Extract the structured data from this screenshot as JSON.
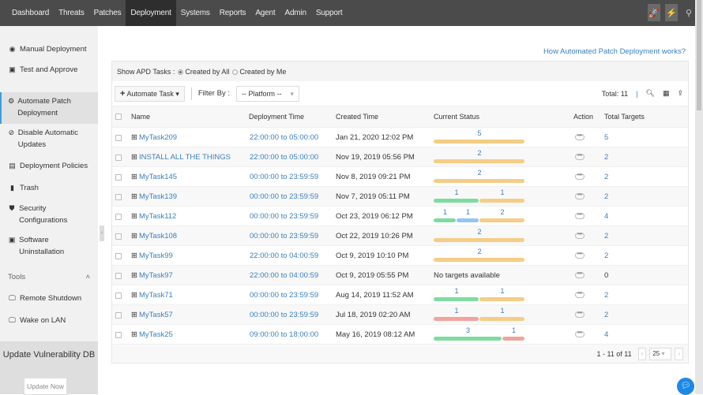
{
  "nav": [
    "Dashboard",
    "Threats",
    "Patches",
    "Deployment",
    "Systems",
    "Reports",
    "Agent",
    "Admin",
    "Support"
  ],
  "nav_active": "Deployment",
  "sidebar": {
    "items": [
      {
        "label": "Manual Deployment",
        "icon": "eye-icon"
      },
      {
        "label": "Test and Approve",
        "icon": "calendar-check-icon"
      },
      {
        "label": "Automate Patch Deployment",
        "icon": "gear-icon"
      },
      {
        "label": "Disable Automatic Updates",
        "icon": "disable-icon"
      },
      {
        "label": "Deployment Policies",
        "icon": "document-icon"
      },
      {
        "label": "Trash",
        "icon": "trash-icon"
      },
      {
        "label": "Security Configurations",
        "icon": "shield-icon"
      },
      {
        "label": "Software Uninstallation",
        "icon": "uninstall-icon"
      }
    ],
    "tools_label": "Tools",
    "tools": [
      {
        "label": "Remote Shutdown"
      },
      {
        "label": "Wake on LAN"
      }
    ],
    "update_title": "Update Vulnerability DB",
    "update_button": "Update Now"
  },
  "help_link": "How Automated Patch Deployment works?",
  "filter": {
    "show_label": "Show APD Tasks :",
    "opt_all": "Created by All",
    "opt_me": "Created by Me",
    "selected": "Created by All"
  },
  "toolbar": {
    "automate": "Automate Task",
    "filter_by": "Filter By :",
    "platform": "-- Platform --",
    "total": "Total: 11"
  },
  "columns": {
    "name": "Name",
    "deploy": "Deployment Time",
    "created": "Created Time",
    "status": "Current Status",
    "action": "Action",
    "targets": "Total Targets"
  },
  "status_colors": {
    "success": "#7ddca0",
    "in_progress": "#93c5f2",
    "pending": "#f5cd86",
    "failed": "#f2a39c"
  },
  "rows": [
    {
      "name": "MyTask209",
      "deploy": "22:00:00 to 05:00:00",
      "created": "Jan 21, 2020 12:02 PM",
      "status": [
        [
          "pending",
          5
        ]
      ],
      "targets": "5"
    },
    {
      "name": "INSTALL ALL THE THINGS",
      "deploy": "22:00:00 to 05:00:00",
      "created": "Nov 19, 2019 05:56 PM",
      "status": [
        [
          "pending",
          2
        ]
      ],
      "targets": "2"
    },
    {
      "name": "MyTask145",
      "deploy": "00:00:00 to 23:59:59",
      "created": "Nov 8, 2019 09:21 PM",
      "status": [
        [
          "pending",
          2
        ]
      ],
      "targets": "2"
    },
    {
      "name": "MyTask139",
      "deploy": "00:00:00 to 23:59:59",
      "created": "Nov 7, 2019 05:11 PM",
      "status": [
        [
          "success",
          1
        ],
        [
          "pending",
          1
        ]
      ],
      "targets": "2"
    },
    {
      "name": "MyTask112",
      "deploy": "00:00:00 to 23:59:59",
      "created": "Oct 23, 2019 06:12 PM",
      "status": [
        [
          "success",
          1
        ],
        [
          "in_progress",
          1
        ],
        [
          "pending",
          2
        ]
      ],
      "targets": "4"
    },
    {
      "name": "MyTask108",
      "deploy": "00:00:00 to 23:59:59",
      "created": "Oct 22, 2019 10:26 PM",
      "status": [
        [
          "pending",
          2
        ]
      ],
      "targets": "2"
    },
    {
      "name": "MyTask99",
      "deploy": "22:00:00 to 04:00:59",
      "created": "Oct 9, 2019 10:10 PM",
      "status": [
        [
          "pending",
          2
        ]
      ],
      "targets": "2"
    },
    {
      "name": "MyTask97",
      "deploy": "22:00:00 to 04:00:59",
      "created": "Oct 9, 2019 05:55 PM",
      "status": [],
      "status_text": "No targets available",
      "targets": "0"
    },
    {
      "name": "MyTask71",
      "deploy": "00:00:00 to 23:59:59",
      "created": "Aug 14, 2019 11:52 AM",
      "status": [
        [
          "success",
          1
        ],
        [
          "pending",
          1
        ]
      ],
      "targets": "2"
    },
    {
      "name": "MyTask57",
      "deploy": "00:00:00 to 23:59:59",
      "created": "Jul 18, 2019 02:20 AM",
      "status": [
        [
          "failed",
          1
        ],
        [
          "pending",
          1
        ]
      ],
      "targets": "2"
    },
    {
      "name": "MyTask25",
      "deploy": "09:00:00 to 18:00:00",
      "created": "May 16, 2019 08:12 AM",
      "status": [
        [
          "success",
          3
        ],
        [
          "failed",
          1
        ]
      ],
      "targets": "4"
    }
  ],
  "pagination": {
    "range": "1 - 11 of 11",
    "per_page": "25"
  }
}
